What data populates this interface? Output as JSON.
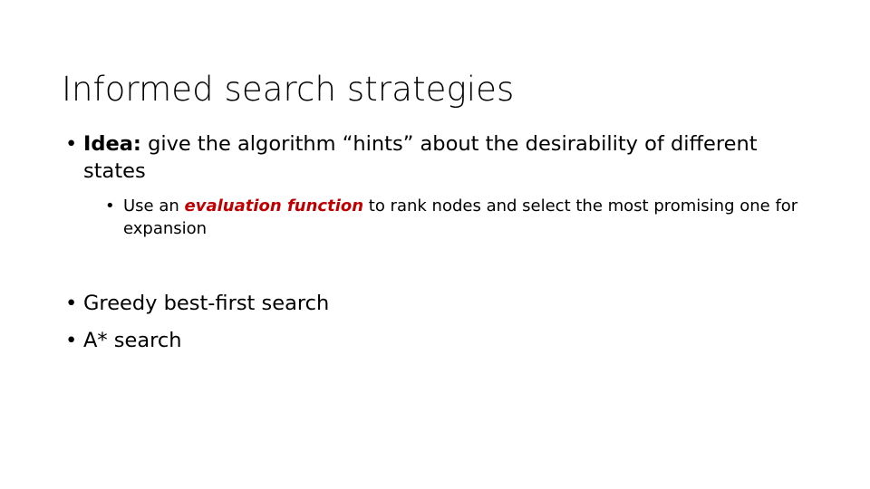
{
  "slide": {
    "title": "Informed search strategies",
    "bullets": [
      {
        "marker": "•",
        "lead": "Idea:",
        "text": " give the algorithm “hints” about the desirability of different states"
      },
      {
        "marker": "•",
        "text_before": "Use an ",
        "emphasis": "evaluation function",
        "text_after": " to rank nodes and select the most promising one for expansion"
      },
      {
        "marker": "•",
        "text": "Greedy best-first search"
      },
      {
        "marker": "•",
        "text": "A* search"
      }
    ]
  },
  "colors": {
    "background": "#FFFFFF",
    "text": "#000000",
    "emphasis": "#C00000"
  }
}
